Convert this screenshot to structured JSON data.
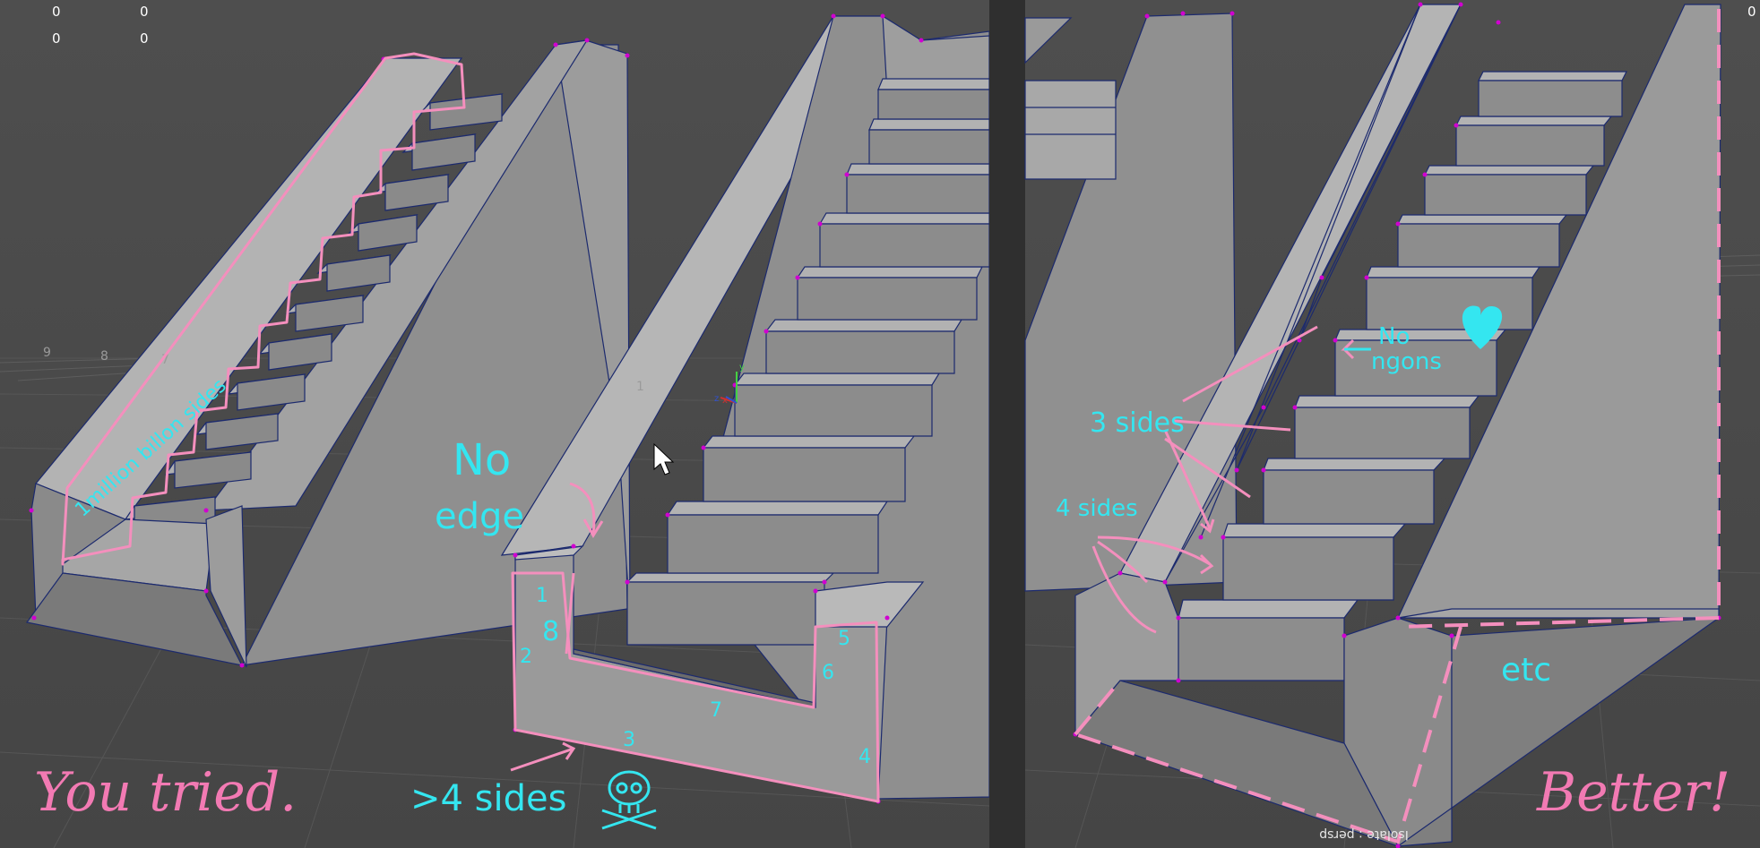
{
  "hud": {
    "top_left_values": [
      "0",
      "0",
      "0",
      "0"
    ],
    "top_right_value": "0",
    "grid_labels": [
      "9",
      "8",
      "7",
      "1"
    ],
    "camera_label": "Isolate : persp"
  },
  "annotations": {
    "left_title": "You tried.",
    "right_title": "Better!",
    "million": "1million billon sides",
    "no_edge_1": "No",
    "no_edge_2": "edge",
    "gt4": ">4 sides",
    "face_numbers": [
      "1",
      "8",
      "2",
      "3",
      "7",
      "5",
      "6",
      "4"
    ],
    "no_ngons_1": "No",
    "no_ngons_2": "ngons",
    "three_sides": "3 sides",
    "four_sides": "4 sides",
    "etc": "etc"
  },
  "axis_gizmo": {
    "x": "x",
    "y": "y",
    "z": "z"
  },
  "colors": {
    "viewport_bg": "#4a4a4a",
    "divider": "#2f2f2f",
    "mesh_light": "#a9a9a9",
    "mesh_dark": "#767676",
    "wire": "#1c2a6e",
    "vertex": "#d000d0",
    "pink": "#f48fbd",
    "cyan": "#34e6f0"
  },
  "icons": [
    "skull-icon",
    "heart-icon",
    "mouse-cursor-icon"
  ]
}
